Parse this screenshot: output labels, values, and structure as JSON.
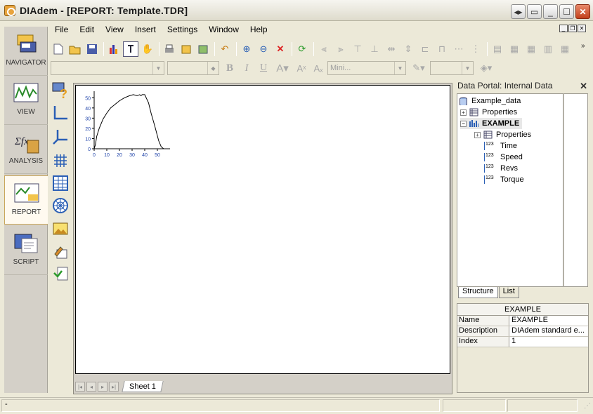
{
  "window": {
    "title": "DIAdem - [REPORT:    Template.TDR]"
  },
  "menu": [
    "File",
    "Edit",
    "View",
    "Insert",
    "Settings",
    "Window",
    "Help"
  ],
  "navigator": {
    "items": [
      {
        "label": "NAVIGATOR",
        "icon": "navigator-icon"
      },
      {
        "label": "VIEW",
        "icon": "view-icon"
      },
      {
        "label": "ANALYSIS",
        "icon": "analysis-icon"
      },
      {
        "label": "REPORT",
        "icon": "report-icon",
        "active": true
      },
      {
        "label": "SCRIPT",
        "icon": "script-icon"
      }
    ]
  },
  "format_toolbar": {
    "font_combo": "",
    "size_combo": "",
    "line_combo": "Mini..."
  },
  "report": {
    "sheet_tab": "Sheet 1"
  },
  "chart_data": {
    "type": "line",
    "x": [
      0,
      1,
      2,
      4,
      7,
      10,
      13,
      16,
      20,
      24,
      28,
      31,
      34,
      36,
      37,
      38,
      40,
      43,
      45,
      48,
      51,
      53,
      55
    ],
    "series": [
      {
        "values": [
          0,
          4,
          12,
          20,
          29,
          35,
          40,
          43,
          47,
          50,
          52,
          53,
          52,
          53,
          52,
          53,
          53,
          45,
          35,
          22,
          8,
          2,
          0
        ]
      }
    ],
    "xticks": [
      "0",
      "10",
      "20",
      "30",
      "40",
      "50"
    ],
    "yticks": [
      "0",
      "10",
      "20",
      "30",
      "40",
      "50"
    ],
    "xlim": [
      0,
      60
    ],
    "ylim": [
      0,
      55
    ],
    "title": "",
    "xlabel": "",
    "ylabel": ""
  },
  "portal": {
    "title": "Data Portal: Internal Data",
    "close": "✕",
    "tree": [
      {
        "label": "Example_data",
        "level": 0,
        "icon": "database-icon"
      },
      {
        "label": "Properties",
        "level": 1,
        "icon": "properties-icon",
        "expander": "+"
      },
      {
        "label": "EXAMPLE",
        "level": 1,
        "icon": "channel-group-icon",
        "expander": "−",
        "bold": true
      },
      {
        "label": "Properties",
        "level": 2,
        "icon": "properties-icon",
        "expander": "+"
      },
      {
        "label": "Time",
        "level": 2,
        "icon": "numeric-channel-icon"
      },
      {
        "label": "Speed",
        "level": 2,
        "icon": "numeric-channel-icon"
      },
      {
        "label": "Revs",
        "level": 2,
        "icon": "numeric-channel-icon"
      },
      {
        "label": "Torque",
        "level": 2,
        "icon": "numeric-channel-icon"
      }
    ],
    "tabs": [
      "Structure",
      "List"
    ],
    "properties": {
      "header": "EXAMPLE",
      "rows": [
        {
          "key": "Name",
          "value": "EXAMPLE"
        },
        {
          "key": "Description",
          "value": "DIAdem standard e..."
        },
        {
          "key": "Index",
          "value": "1"
        }
      ]
    }
  },
  "status": {
    "left": "-"
  }
}
